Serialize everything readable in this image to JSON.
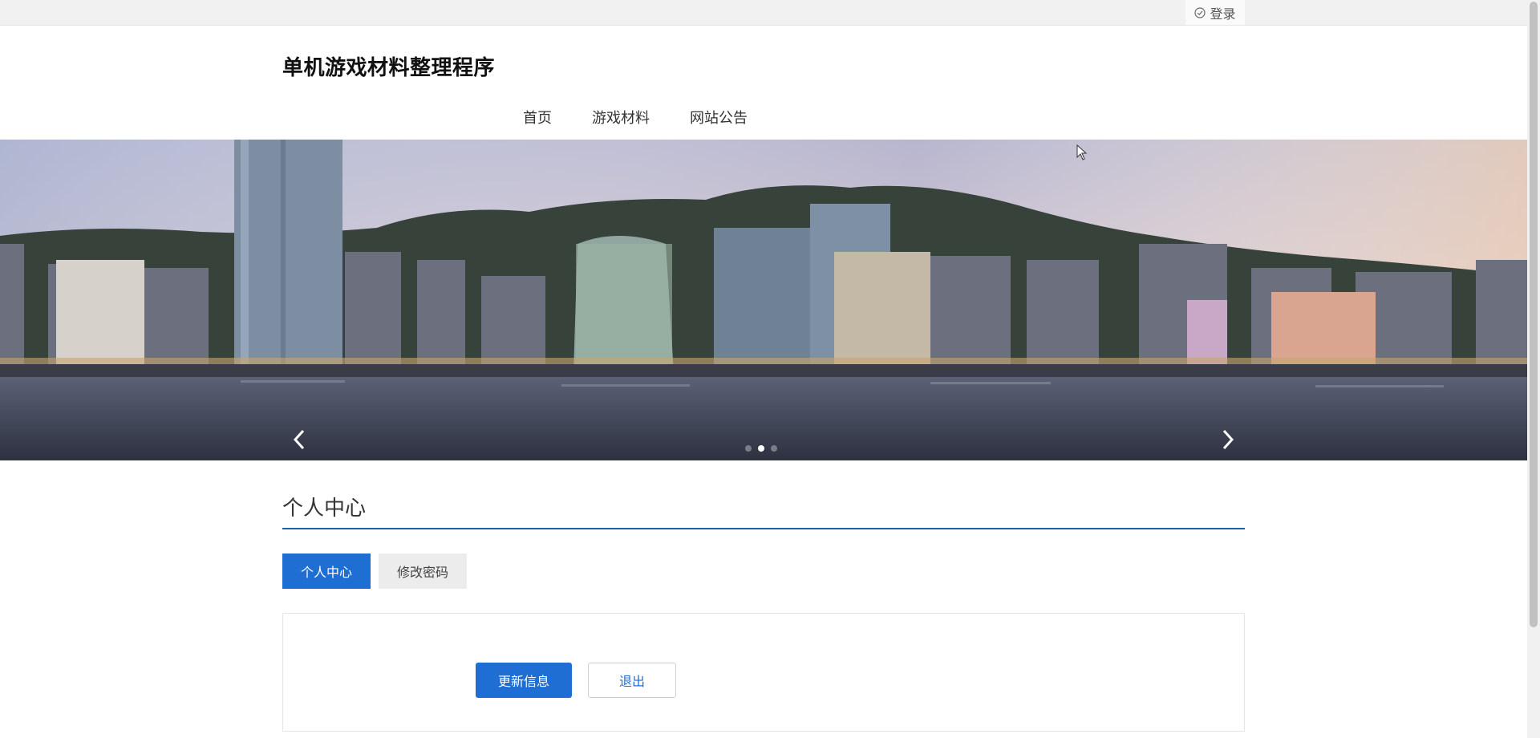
{
  "topbar": {
    "login_label": "登录",
    "login_icon": "check-circle-icon"
  },
  "header": {
    "title": "单机游戏材料整理程序"
  },
  "nav": {
    "items": [
      {
        "label": "首页"
      },
      {
        "label": "游戏材料"
      },
      {
        "label": "网站公告"
      }
    ]
  },
  "banner": {
    "image": "city-skyline-harbor",
    "prev_icon": "chevron-left-icon",
    "next_icon": "chevron-right-icon",
    "slide_count": 3,
    "active_slide": 2
  },
  "section": {
    "title": "个人中心"
  },
  "tabs": [
    {
      "label": "个人中心",
      "active": true
    },
    {
      "label": "修改密码",
      "active": false
    }
  ],
  "panel": {
    "update_label": "更新信息",
    "logout_label": "退出"
  },
  "colors": {
    "primary": "#1f6ed4",
    "underline": "#1f5fae",
    "topbar_bg": "#f1f1f1"
  }
}
